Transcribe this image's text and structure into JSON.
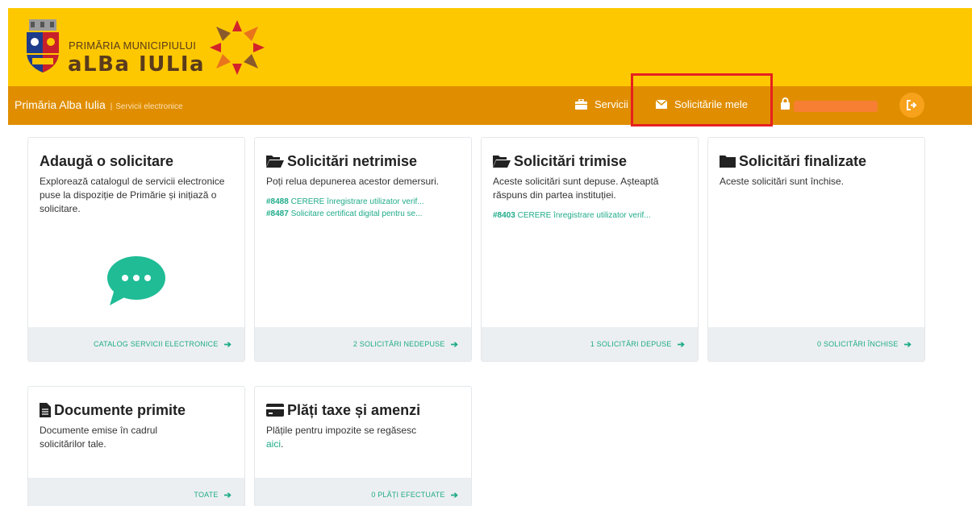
{
  "header": {
    "logo_top": "PRIMĂRIA MUNICIPIULUI",
    "logo_main": "aLBa IULIa",
    "brand": "Primăria Alba Iulia",
    "brand_sep": "|",
    "brand_sub": "Servicii electronice",
    "nav": {
      "servicii": "Servicii",
      "solicitari": "Solicitările mele"
    }
  },
  "cards": {
    "add": {
      "title": "Adaugă o solicitare",
      "text": "Explorează catalogul de servicii electronice puse la dispoziție de Primărie și inițiază o solicitare.",
      "footer": "CATALOG SERVICII ELECTRONICE"
    },
    "netrimise": {
      "title": "Solicitări netrimise",
      "text": "Poți relua depunerea acestor demersuri.",
      "links": [
        {
          "id": "#8488",
          "label": "CERERE înregistrare utilizator verif..."
        },
        {
          "id": "#8487",
          "label": "Solicitare certificat digital pentru se..."
        }
      ],
      "footer": "2 SOLICITĂRI NEDEPUSE"
    },
    "trimise": {
      "title": "Solicitări trimise",
      "text": "Aceste solicitări sunt depuse. Așteaptă răspuns din partea instituției.",
      "links": [
        {
          "id": "#8403",
          "label": "CERERE înregistrare utilizator verif..."
        }
      ],
      "footer": "1 SOLICITĂRI DEPUSE"
    },
    "finalizate": {
      "title": "Solicitări finalizate",
      "text": "Aceste solicitări sunt închise.",
      "footer": "0 SOLICITĂRI ÎNCHISE"
    },
    "documente": {
      "title": "Documente primite",
      "text": "Documente emise în cadrul solicitărilor tale.",
      "footer": "TOATE"
    },
    "plati": {
      "title": "Plăți taxe și amenzi",
      "text": "Plățile pentru impozite se regăsesc",
      "link": "aici",
      "link_suffix": ".",
      "footer": "0 PLĂȚI EFECTUATE"
    }
  },
  "footer_arrow": "➔",
  "colors": {
    "header_bg": "#fec800",
    "nav_bg": "#e08e00",
    "accent": "#1fab89",
    "highlight": "#e62020"
  }
}
